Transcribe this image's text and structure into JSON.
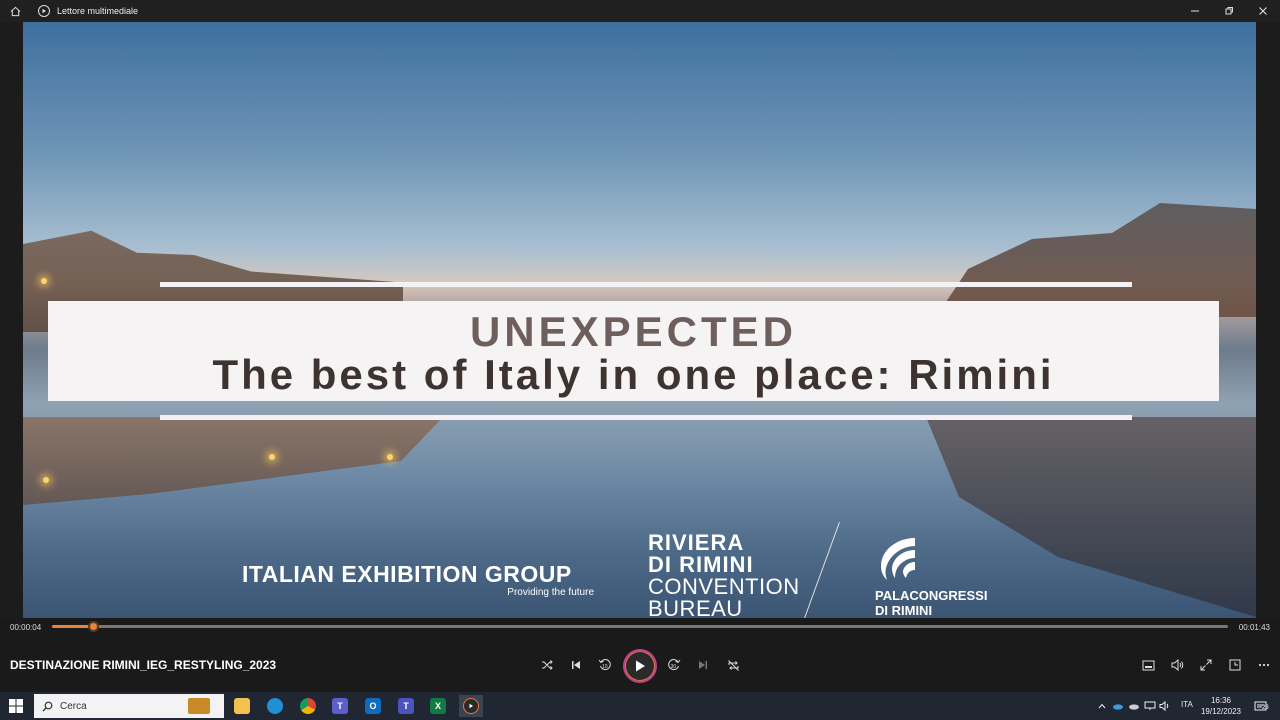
{
  "window": {
    "app_title": "Lettore multimediale",
    "icons": [
      "home-icon",
      "media-player-icon",
      "minimize-icon",
      "restore-icon",
      "close-icon"
    ]
  },
  "video": {
    "headline_top": "UNEXPECTED",
    "headline_main": "The best of Italy in one place: Rimini",
    "logos": {
      "ieg_name": "ITALIAN EXHIBITION GROUP",
      "ieg_tagline": "Providing the future",
      "riviera_line1": "RIVIERA",
      "riviera_line2": "DI RIMINI",
      "riviera_line3": "CONVENTION",
      "riviera_line4": "BUREAU",
      "pala_line1": "PALACONGRESSI",
      "pala_line2": "DI RIMINI"
    }
  },
  "player": {
    "current_time": "00:00:04",
    "duration": "00:01:43",
    "progress_fraction": 0.035,
    "media_title": "DESTINAZIONE RIMINI_IEG_RESTYLING_2023",
    "accent_color": "#e8843a",
    "controls": [
      "shuffle-icon",
      "previous-icon",
      "rewind-10-icon",
      "play-icon",
      "forward-30-icon",
      "next-icon",
      "repeat-off-icon"
    ],
    "right_controls": [
      "miniplayer-icon",
      "volume-icon",
      "fullscreen-icon",
      "compact-view-icon",
      "more-icon"
    ]
  },
  "taskbar": {
    "search_placeholder": "Cerca",
    "apps": [
      "file-explorer-icon",
      "edge-icon",
      "chrome-icon",
      "teams-icon",
      "outlook-icon",
      "teams-classic-icon",
      "excel-icon",
      "media-player-icon"
    ],
    "language": "ITA",
    "time": "16:36",
    "date": "19/12/2023",
    "notification_count": "23"
  }
}
